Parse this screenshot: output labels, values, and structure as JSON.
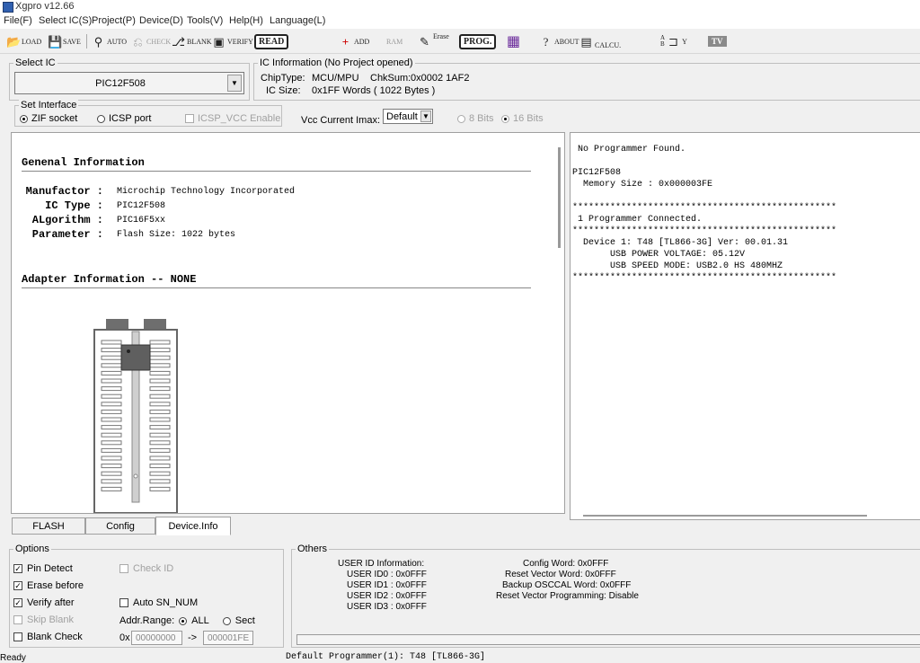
{
  "window": {
    "title": "Xgpro v12.66"
  },
  "menu": [
    "File(F)",
    "Select IC(S)",
    "Project(P)",
    "Device(D)",
    "Tools(V)",
    "Help(H)",
    "Language(L)"
  ],
  "toolbar": {
    "load": "LOAD",
    "save": "SAVE",
    "auto": "AUTO",
    "check": "CHECK",
    "blank": "BLANK",
    "verify": "VERIFY",
    "read": "READ",
    "add": "ADD",
    "ram": "RAM",
    "erase": "Erase",
    "prog": "PROG.",
    "about": "ABOUT",
    "calcu": "CALCU.",
    "logic_a": "A",
    "logic_b": "B",
    "logic_y": "Y",
    "tv": "TV"
  },
  "select_ic": {
    "legend": "Select IC",
    "value": "PIC12F508"
  },
  "ic_info": {
    "legend": "IC Information (No Project opened)",
    "chip_type_label": "ChipType:",
    "chip_type": "MCU/MPU",
    "chksum_label": "ChkSum:",
    "chksum": "0x0002 1AF2",
    "ic_size_label": "IC Size:",
    "ic_size": "0x1FF Words ( 1022 Bytes )"
  },
  "interface": {
    "legend": "Set Interface",
    "zif": "ZIF socket",
    "icsp": "ICSP port",
    "icsp_vcc": "ICSP_VCC Enable",
    "vcc_label": "Vcc Current Imax:",
    "vcc_value": "Default",
    "bits8": "8 Bits",
    "bits16": "16 Bits"
  },
  "device_info": {
    "general_heading": "Genenal Information",
    "rows": [
      {
        "key": "Manufactor",
        "value": "Microchip Technology Incorporated"
      },
      {
        "key": "IC Type",
        "value": "PIC12F508"
      },
      {
        "key": "ALgorithm",
        "value": "PIC16F5xx"
      },
      {
        "key": "Parameter",
        "value": "Flash Size: 1022 bytes"
      }
    ],
    "adapter_heading": "Adapter Information -- NONE"
  },
  "log": [
    "No Programmer Found.",
    "",
    "PIC12F508",
    "  Memory Size : 0x000003FE",
    "",
    "*************************************************",
    " 1 Programmer Connected.",
    "*************************************************",
    "  Device 1: T48 [TL866-3G] Ver: 00.01.31",
    "       USB POWER VOLTAGE: 05.12V",
    "       USB SPEED MODE: USB2.0 HS 480MHZ",
    "*************************************************"
  ],
  "tabs": [
    "FLASH",
    "Config",
    "Device.Info"
  ],
  "options": {
    "legend": "Options",
    "pin_detect": "Pin Detect",
    "check_id": "Check ID",
    "erase_before": "Erase before",
    "verify_after": "Verify after",
    "auto_sn": "Auto SN_NUM",
    "skip_blank": "Skip Blank",
    "addr_range_label": "Addr.Range:",
    "all": "ALL",
    "sect": "Sect",
    "blank_check": "Blank Check",
    "addr_prefix": "0x",
    "addr_from": "00000000",
    "addr_arrow": "->",
    "addr_to": "000001FE"
  },
  "others": {
    "legend": "Others",
    "left": [
      "USER ID Information:",
      "USER ID0 : 0x0FFF",
      "USER ID1 : 0x0FFF",
      "USER ID2 : 0x0FFF",
      "USER ID3 : 0x0FFF"
    ],
    "right": [
      "Config Word: 0x0FFF",
      "Reset Vector Word: 0x0FFF",
      "Backup OSCCAL Word: 0x0FFF",
      "Reset Vector Programming: Disable"
    ]
  },
  "status": {
    "left": "Ready",
    "programmer": "Default Programmer(1): T48 [TL866-3G]"
  }
}
